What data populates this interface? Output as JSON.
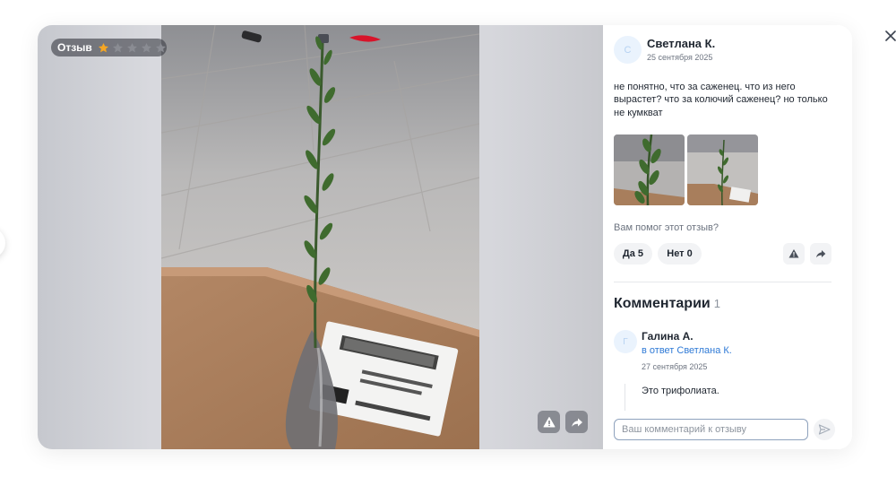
{
  "media": {
    "rating_label": "Отзыв",
    "rating": 1,
    "rating_max": 5
  },
  "review": {
    "author_name": "Светлана К.",
    "author_initial": "С",
    "date": "25 сентября 2025",
    "text": "не понятно, что за саженец. что из него вырастет? что за колючий саженец? но только не кумкват",
    "photo_count": 2
  },
  "helpful": {
    "question": "Вам помог этот отзыв?",
    "yes_label": "Да 5",
    "no_label": "Нет 0"
  },
  "comments": {
    "title": "Комментарии",
    "count": "1",
    "items": [
      {
        "author": "Галина А.",
        "initial": "Г",
        "reply_to": "в ответ Светлана К.",
        "date": "27 сентября 2025",
        "text": "Это трифолиата."
      }
    ]
  },
  "comment_input": {
    "placeholder": "Ваш комментарий к отзыву",
    "value": ""
  },
  "icons": {
    "close": "close-icon",
    "complain": "warning-icon",
    "share": "share-icon",
    "send": "send-icon",
    "star": "star-icon"
  },
  "colors": {
    "star_filled": "#f5a623",
    "star_empty": "#8a8c93",
    "link": "#2f7ad6",
    "avatar_bg": "#eaf3fd"
  }
}
